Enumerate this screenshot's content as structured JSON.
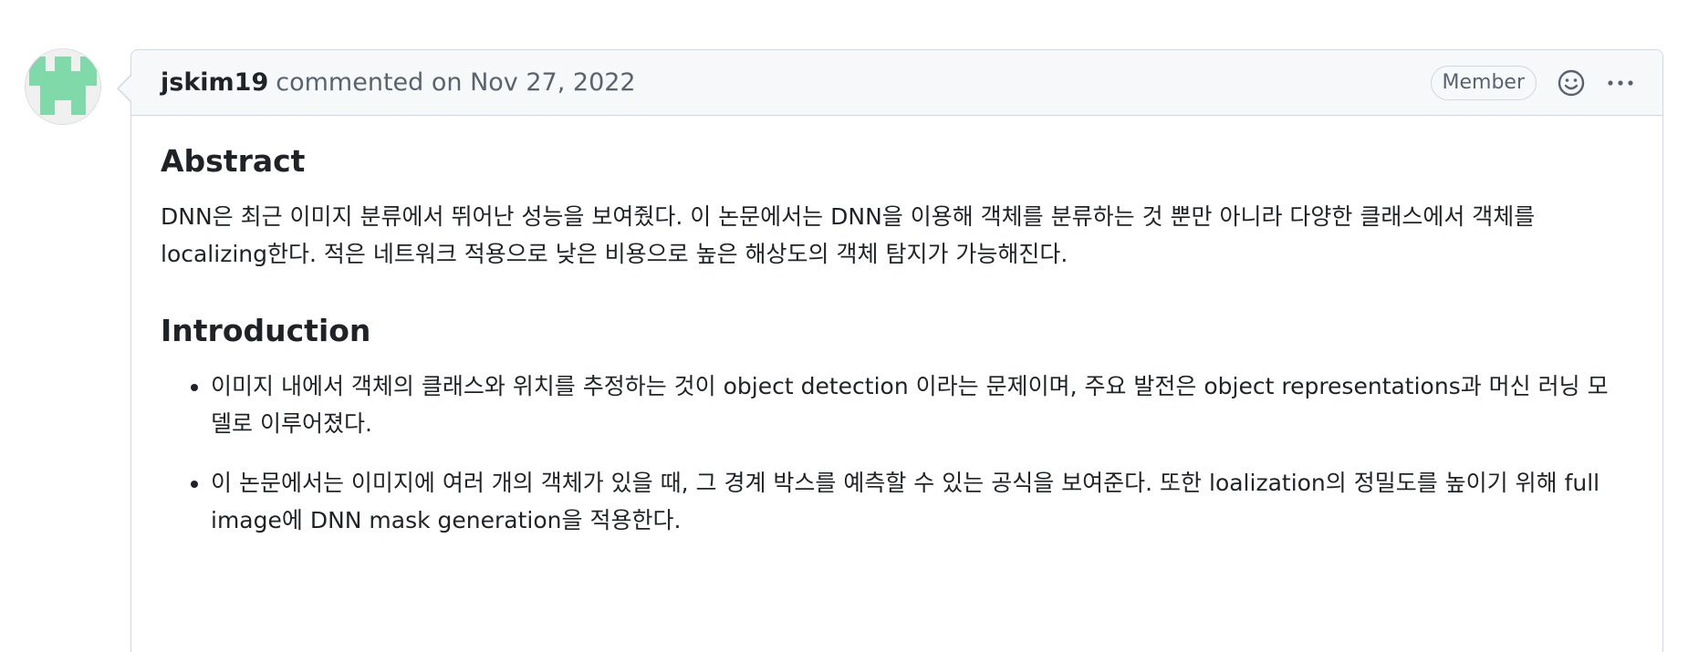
{
  "comment": {
    "author": "jskim19",
    "action": "commented on",
    "date": "Nov 27, 2022",
    "role_badge": "Member",
    "reaction_icon": "smiley-icon",
    "menu_icon": "kebab-horizontal-icon",
    "avatar_color": "#7fd9a8"
  },
  "content": {
    "abstract_heading": "Abstract",
    "abstract_text": "DNN은 최근 이미지 분류에서 뛰어난 성능을 보여줬다. 이 논문에서는 DNN을 이용해 객체를 분류하는 것 뿐만 아니라 다양한 클래스에서 객체를 localizing한다. 적은 네트워크 적용으로 낮은 비용으로 높은 해상도의 객체 탐지가 가능해진다.",
    "introduction_heading": "Introduction",
    "introduction_items": [
      "이미지 내에서 객체의 클래스와 위치를 추정하는 것이 object detection 이라는 문제이며, 주요 발전은 object representations과 머신 러닝 모델로 이루어졌다.",
      "이 논문에서는 이미지에 여러 개의 객체가 있을 때, 그 경계 박스를 예측할 수 있는 공식을 보여준다. 또한 loalization의 정밀도를 높이기 위해 full image에 DNN mask generation을 적용한다."
    ]
  }
}
